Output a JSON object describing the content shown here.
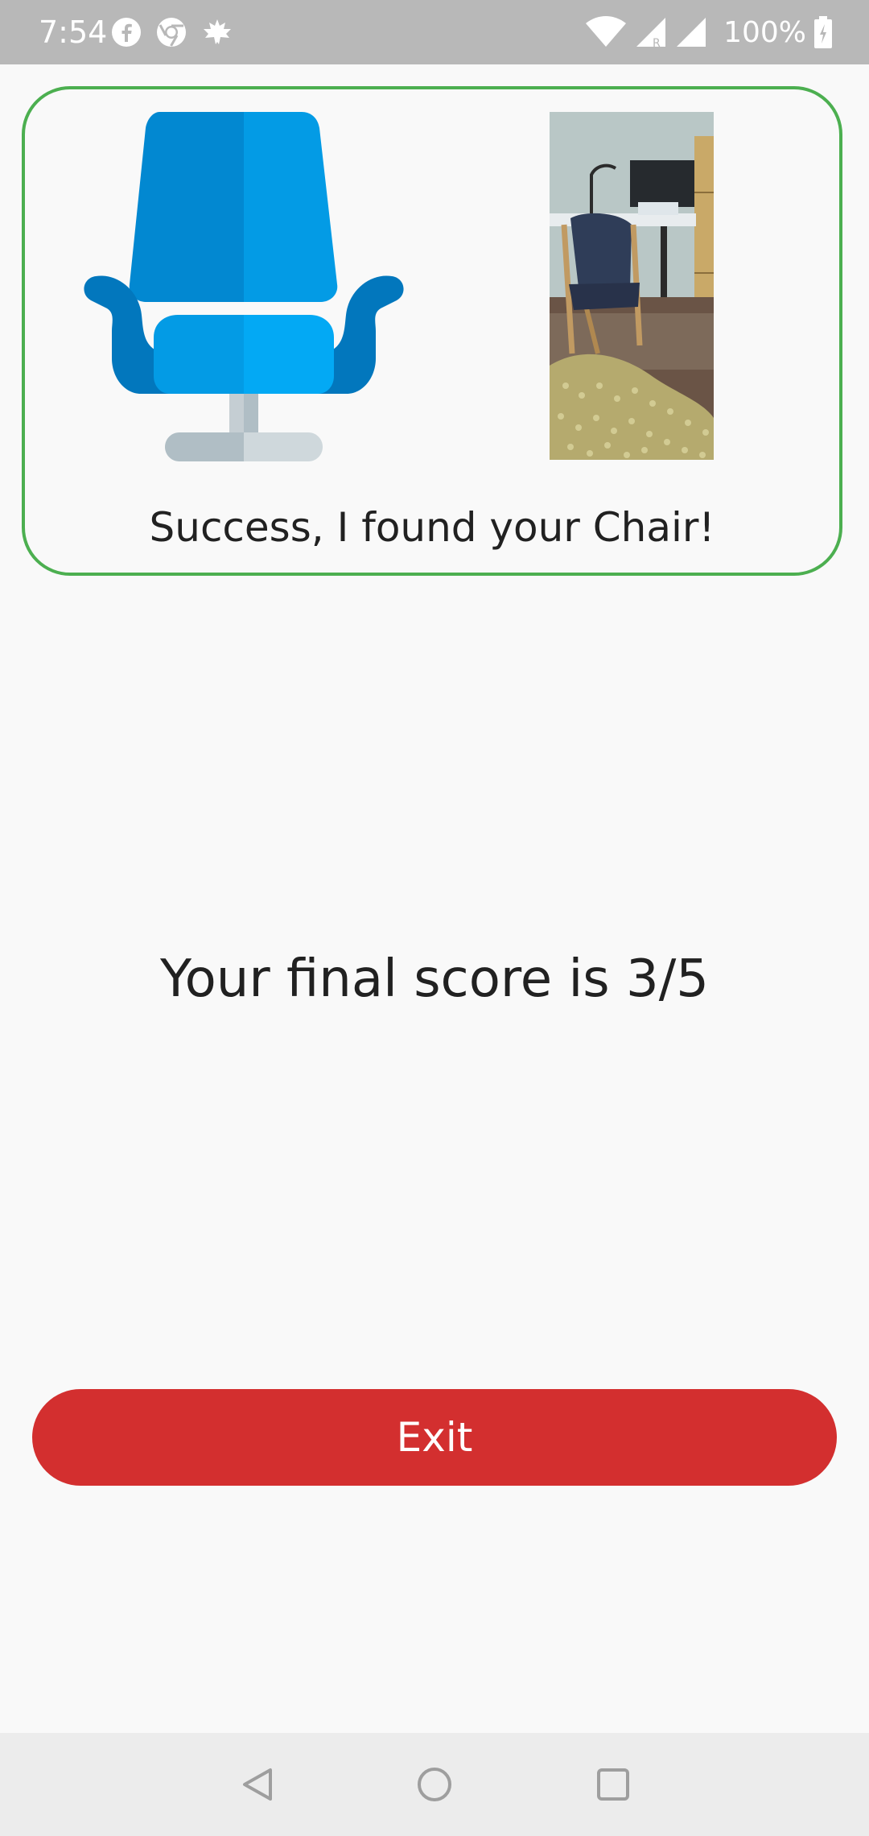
{
  "status_bar": {
    "time": "7:54",
    "notification_icons": [
      "facebook-icon",
      "chrome-icon",
      "leaf-icon"
    ],
    "system_icons": [
      "wifi-icon",
      "cell-signal-icon",
      "cell-signal-icon"
    ],
    "battery": "100%"
  },
  "result_card": {
    "illustration": "chair-icon",
    "photo": "captured-chair-photo",
    "message": "Success, I found your Chair!",
    "border_color": "#4caf50"
  },
  "score": {
    "text": "Your final score is 3/5"
  },
  "exit_button": {
    "label": "Exit",
    "color": "#d32f2f"
  },
  "nav_bar": {
    "buttons": [
      "back-icon",
      "home-icon",
      "recents-icon"
    ]
  }
}
